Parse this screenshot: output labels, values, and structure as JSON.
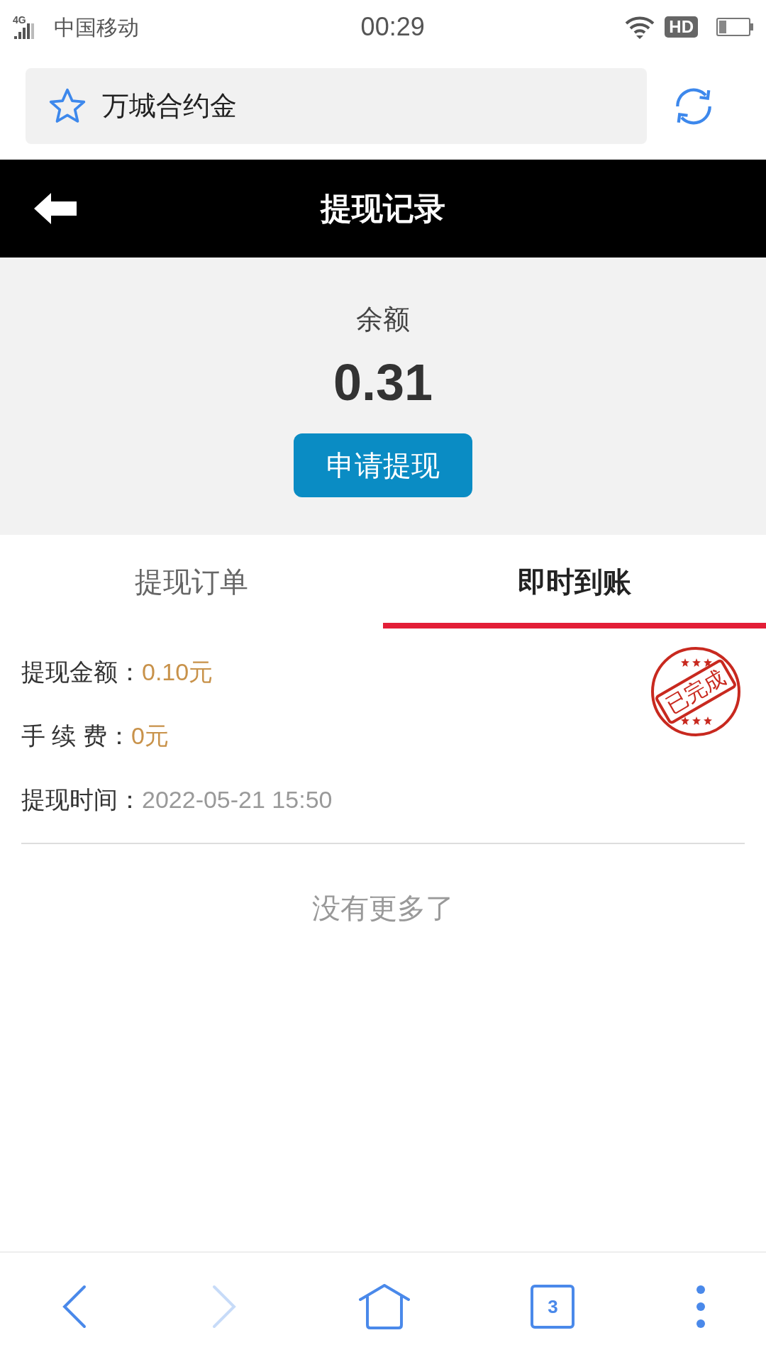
{
  "status_bar": {
    "network": "4G",
    "carrier": "中国移动",
    "time": "00:29",
    "hd": "HD"
  },
  "address_bar": {
    "title": "万城合约金"
  },
  "header": {
    "title": "提现记录"
  },
  "balance": {
    "label": "余额",
    "amount": "0.31",
    "button": "申请提现"
  },
  "tabs": [
    {
      "label": "提现订单",
      "selected": false
    },
    {
      "label": "即时到账",
      "selected": true
    }
  ],
  "records": [
    {
      "fields": [
        {
          "label": "提现金额：",
          "value": "0.10元",
          "kind": "money"
        },
        {
          "label": "手 续 费：",
          "value": "0元",
          "kind": "money"
        },
        {
          "label": "提现时间：",
          "value": "2022-05-21 15:50",
          "kind": "time"
        }
      ],
      "stamp": "已完成"
    }
  ],
  "end_text": "没有更多了",
  "bottom_nav": {
    "back_disabled": false,
    "forward_disabled": true,
    "tab_count": "3"
  }
}
